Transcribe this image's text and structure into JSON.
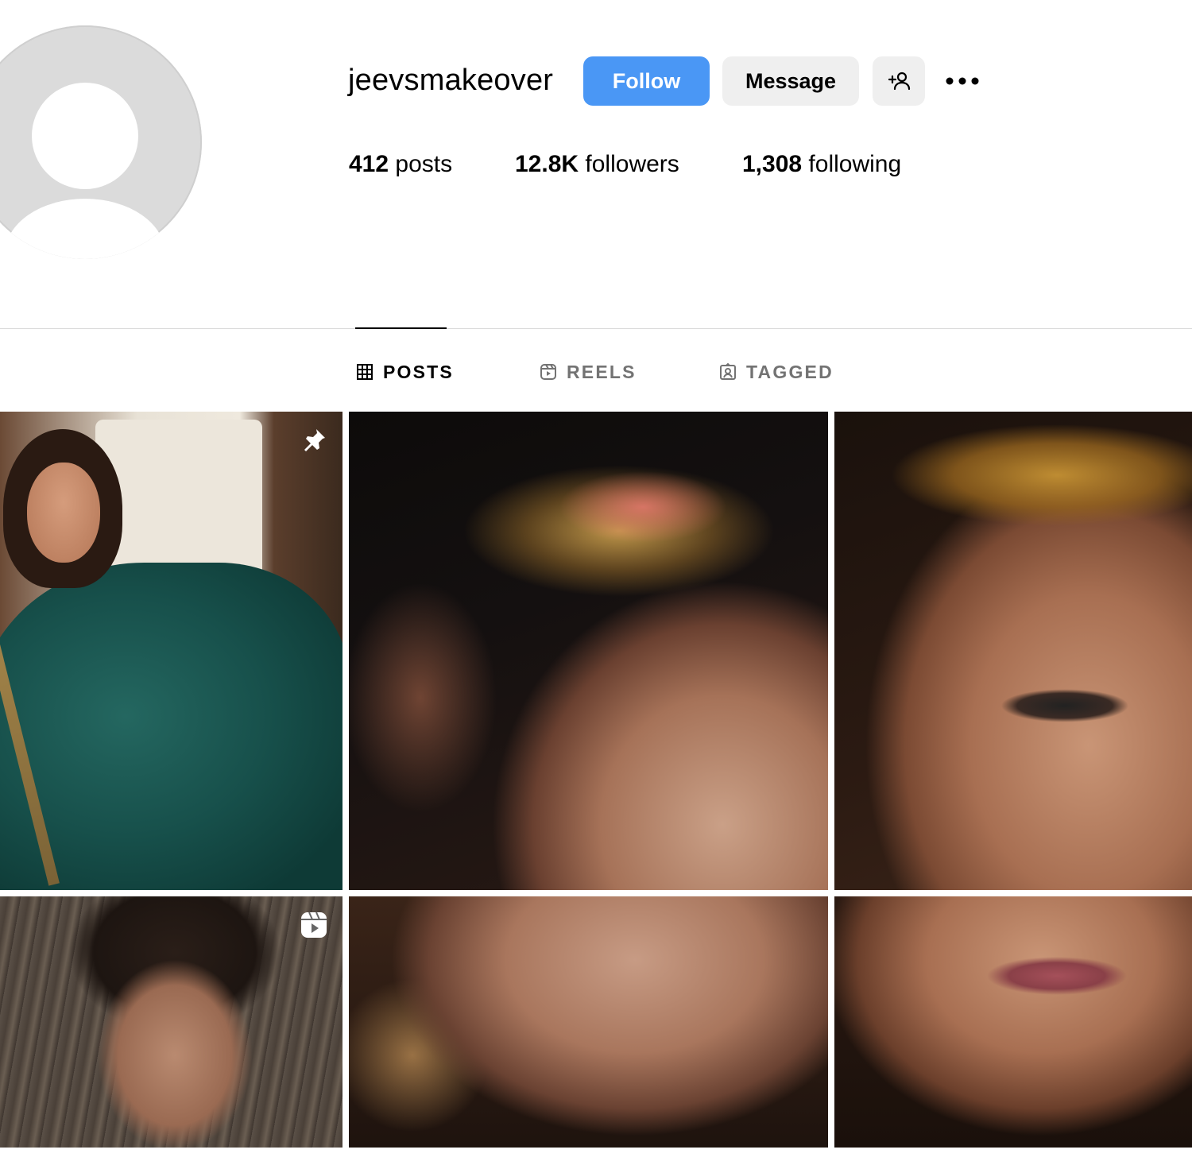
{
  "profile": {
    "username": "jeevsmakeover",
    "follow_label": "Follow",
    "message_label": "Message",
    "stats": {
      "posts_count": "412",
      "posts_label": "posts",
      "followers_count": "12.8K",
      "followers_label": "followers",
      "following_count": "1,308",
      "following_label": "following"
    }
  },
  "tabs": [
    {
      "label": "POSTS",
      "icon": "grid-icon",
      "active": true
    },
    {
      "label": "REELS",
      "icon": "reels-icon",
      "active": false
    },
    {
      "label": "TAGGED",
      "icon": "tagged-icon",
      "active": false
    }
  ],
  "grid": [
    {
      "type": "image",
      "badge": "pin-icon"
    },
    {
      "type": "image",
      "badge": null
    },
    {
      "type": "image",
      "badge": null
    },
    {
      "type": "reel",
      "badge": "reel-icon"
    },
    {
      "type": "image",
      "badge": null
    },
    {
      "type": "image",
      "badge": null
    }
  ],
  "colors": {
    "follow_button": "#4a97f5",
    "secondary_button": "#efefef",
    "muted_text": "#737373",
    "divider": "#dbdbdb"
  }
}
